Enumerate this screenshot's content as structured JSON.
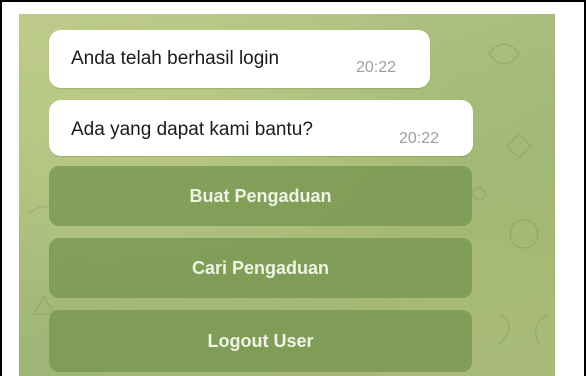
{
  "chat": {
    "messages": [
      {
        "text": "Anda telah berhasil login",
        "time": "20:22"
      },
      {
        "text": "Ada yang dapat kami bantu?",
        "time": "20:22"
      }
    ],
    "keyboard_buttons": [
      {
        "label": "Buat Pengaduan"
      },
      {
        "label": "Cari Pengaduan"
      },
      {
        "label": "Logout User"
      }
    ]
  },
  "colors": {
    "background_green": "#a9bd7c",
    "button_green": "#76964f",
    "bubble": "#ffffff",
    "time_text": "#9aa0a6"
  }
}
